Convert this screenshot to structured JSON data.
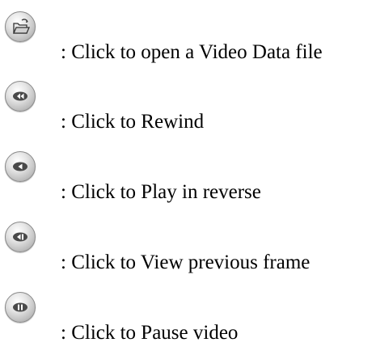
{
  "entries": [
    {
      "icon": "open-folder-icon",
      "text": ": Click to open a Video Data file"
    },
    {
      "icon": "rewind-icon",
      "text": ": Click to Rewind"
    },
    {
      "icon": "play-reverse-icon",
      "text": ": Click to Play in reverse"
    },
    {
      "icon": "previous-frame-icon",
      "text": ": Click to View previous frame"
    },
    {
      "icon": "pause-icon",
      "text": ": Click to Pause video"
    }
  ]
}
